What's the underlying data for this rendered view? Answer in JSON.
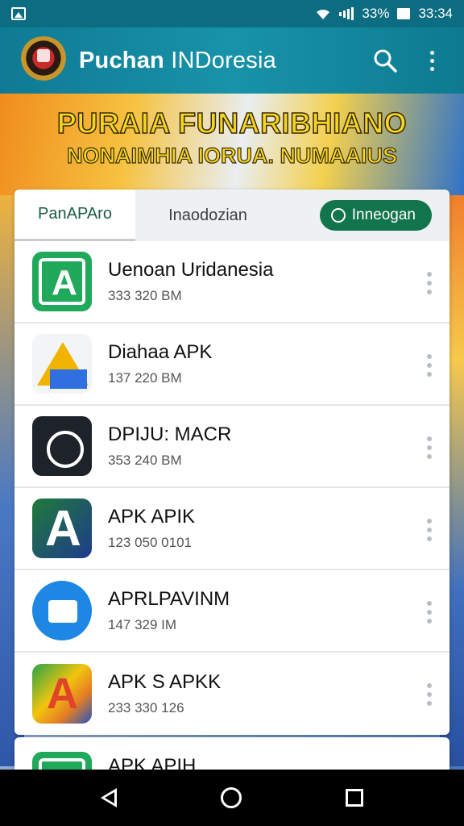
{
  "statusbar": {
    "battery_text": "33%",
    "time": "33:34",
    "icons": [
      "gallery-icon",
      "wifi-icon",
      "signal-icon",
      "battery-icon"
    ]
  },
  "appbar": {
    "title_bold": "Puchan ",
    "title_thin": "INDoresia",
    "icons": [
      "search-icon",
      "more-vert-icon"
    ]
  },
  "banner": {
    "line1": "PURAIA FUNARIBHIANO",
    "line2": "NONAIMHIA IORUA. NUMAAIUS"
  },
  "tabs": {
    "active_label": "PanAPAro",
    "inactive_label": "Inaodozian",
    "filter_label": "Inneogan"
  },
  "apps": [
    {
      "name": "Uenoan Uridanesia",
      "size": "333 320 BM",
      "icon": "green-app-icon"
    },
    {
      "name": "Diahaa APK",
      "size": "137 220 BM",
      "icon": "drive-app-icon"
    },
    {
      "name": "DPIJU: MACR",
      "size": "353 240 BM",
      "icon": "dark-app-icon"
    },
    {
      "name": "APK APIK",
      "size": "123 050 0101",
      "icon": "gradient-a-icon"
    },
    {
      "name": "APRLPAVINM",
      "size": "147 329 IM",
      "icon": "blue-app-icon"
    },
    {
      "name": "APK S APKK",
      "size": "233 330 126",
      "icon": "multicolor-app-icon"
    }
  ],
  "partial_next": {
    "name": "APK APIH",
    "icon": "green-app-icon"
  },
  "navbar": {
    "icons": [
      "back-icon",
      "home-icon",
      "recents-icon"
    ]
  },
  "colors": {
    "appbar": "#0f7a93",
    "accent": "#12744c"
  }
}
